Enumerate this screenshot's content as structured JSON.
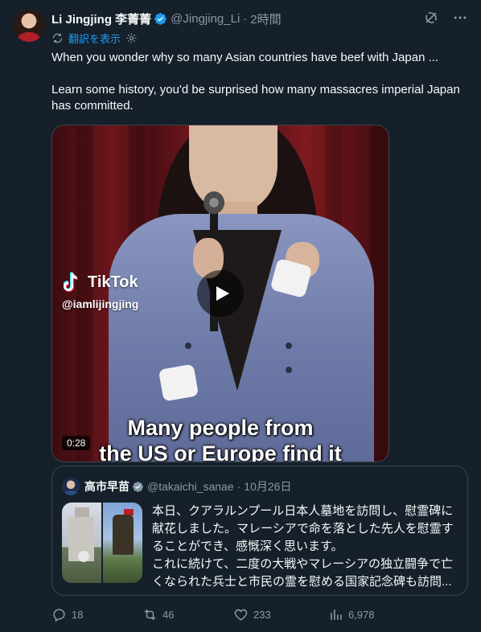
{
  "author": {
    "display_name": "Li Jingjing 李菁菁",
    "handle": "@Jingjing_Li",
    "separator": "·",
    "time": "2時間"
  },
  "translate": {
    "label": "翻訳を表示"
  },
  "tweet": {
    "text": "When you wonder why so many Asian countries have beef with Japan ...\n\nLearn some history, you'd be surprised how many massacres imperial Japan has committed."
  },
  "video": {
    "watermark_brand": "TikTok",
    "watermark_handle": "@iamlijingjing",
    "caption": "Many people from\nthe US or Europe find it",
    "duration": "0:28"
  },
  "quote": {
    "display_name": "高市早苗",
    "handle": "@takaichi_sanae",
    "separator": "·",
    "time": "10月26日",
    "text": "本日、クアラルンプール日本人墓地を訪問し、慰霊碑に献花しました。マレーシアで命を落とした先人を慰霊することができ、感慨深く思います。\nこれに続けて、二度の大戦やマレーシアの独立闘争で亡くなられた兵士と市民の霊を慰める国家記念碑も訪問..."
  },
  "actions": {
    "replies": "18",
    "retweets": "46",
    "likes": "233",
    "views": "6,978"
  },
  "icons": {
    "verified": "verified-badge-icon",
    "grok": "grok-icon",
    "more": "more-icon",
    "translate": "translate-icon",
    "settings": "gear-icon",
    "play": "play-icon",
    "reply": "reply-icon",
    "retweet": "retweet-icon",
    "like": "heart-icon",
    "views": "views-icon",
    "bookmark": "bookmark-icon",
    "share": "share-icon"
  },
  "colors": {
    "background": "#15202b",
    "accent": "#1d9bf0",
    "muted": "#8b98a5",
    "text": "#f7f9f9",
    "border": "#38444d"
  }
}
